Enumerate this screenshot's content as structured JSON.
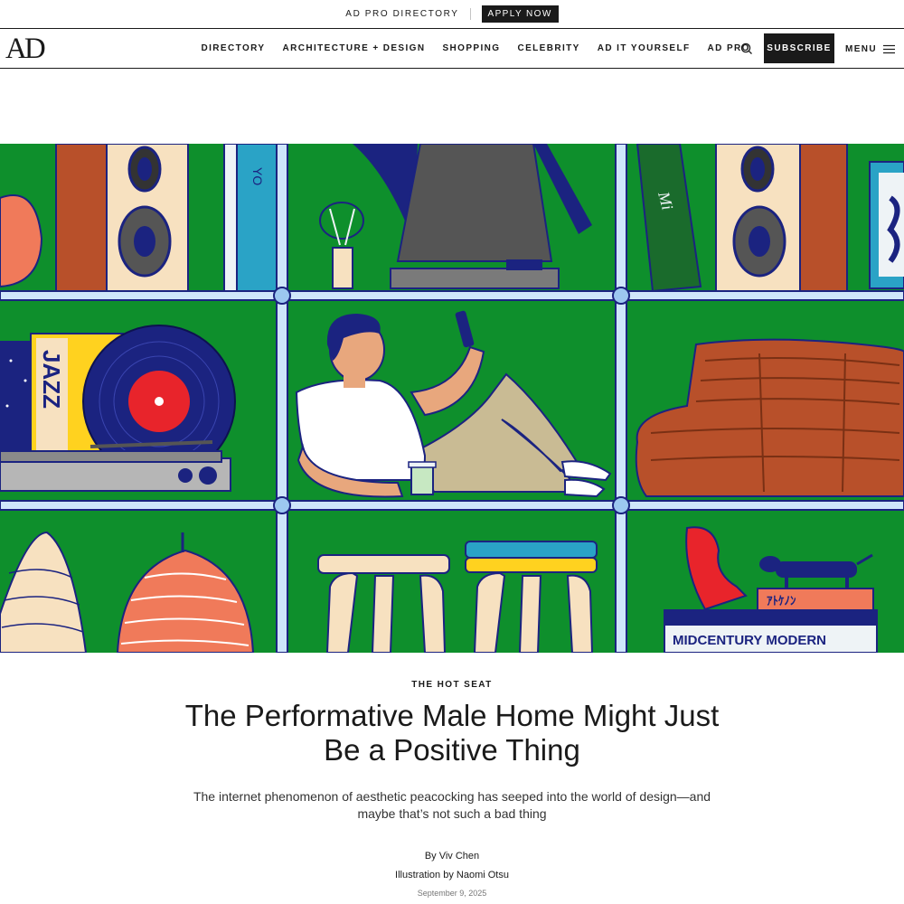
{
  "promo": {
    "directory_link": "AD PRO DIRECTORY",
    "apply_label": "APPLY NOW"
  },
  "nav": {
    "logo": "AD",
    "links": [
      "DIRECTORY",
      "ARCHITECTURE + DESIGN",
      "SHOPPING",
      "CELEBRITY",
      "AD IT YOURSELF",
      "AD PRO"
    ],
    "subscribe_label": "SUBSCRIBE",
    "menu_label": "MENU",
    "search_icon": "search-icon",
    "menu_icon": "hamburger-icon"
  },
  "hero": {
    "jazz_sleeve": "JAZZ",
    "book_spine": "MIDCENTURY MODERN",
    "book_top_spine": "ｱﾄｹﾉﾝ",
    "book_side_letters": "YO",
    "colors": {
      "shelf_green": "#0e8f2c",
      "frame_blue": "#9cc7f0",
      "navy": "#1b2380"
    }
  },
  "article": {
    "rubric": "THE HOT SEAT",
    "headline": "The Performative Male Home Might Just Be a Positive Thing",
    "dek": "The internet phenomenon of aesthetic peacocking has seeped into the world of design—and maybe that’s not such a bad thing",
    "byline": "By Viv Chen",
    "illustration_credit": "Illustration by Naomi Otsu",
    "date": "September 9, 2025"
  }
}
